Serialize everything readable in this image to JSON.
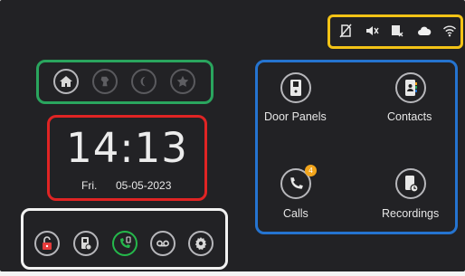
{
  "status_bar": {
    "icons": [
      "no-sim-icon",
      "mute-icon",
      "message-cancel-icon",
      "cloud-icon",
      "wifi-icon"
    ]
  },
  "modes": {
    "items": [
      "home-mode-icon",
      "away-mode-icon",
      "night-mode-icon",
      "custom-mode-icon"
    ]
  },
  "clock": {
    "time": "14:13",
    "day": "Fri.",
    "date": "05-05-2023"
  },
  "quick_actions": {
    "items": [
      "unlock-icon",
      "door-camera-icon",
      "intercom-call-icon",
      "voicemail-icon",
      "settings-icon"
    ]
  },
  "tiles": {
    "door_panels": "Door Panels",
    "contacts": "Contacts",
    "calls": "Calls",
    "calls_badge": "4",
    "recordings": "Recordings"
  },
  "colors": {
    "background": "#222225",
    "status_frame": "#f3c316",
    "modes_frame": "#2aa55e",
    "clock_frame": "#e02424",
    "actions_frame": "#f2f2f2",
    "apps_frame": "#2574d0",
    "badge": "#f2a51c",
    "call_accent": "#25b84b"
  }
}
